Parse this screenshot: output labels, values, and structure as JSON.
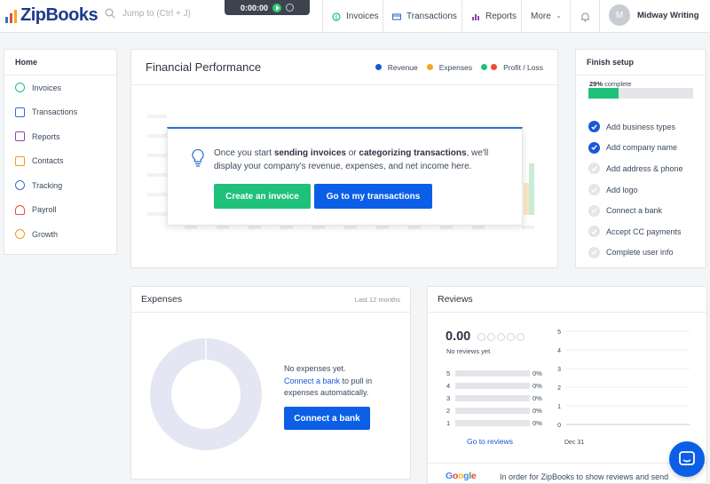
{
  "app": {
    "name": "ZipBooks"
  },
  "search": {
    "placeholder": "Jump to (Ctrl + J)"
  },
  "timer": {
    "time": "0:00:00"
  },
  "nav": [
    {
      "label": "Invoices",
      "icon": "invoice-icon"
    },
    {
      "label": "Transactions",
      "icon": "transactions-icon"
    },
    {
      "label": "Reports",
      "icon": "reports-icon"
    },
    {
      "label": "More",
      "icon": "chevron-down-icon"
    }
  ],
  "user": {
    "initial": "M",
    "name": "Midway Writing"
  },
  "sidebar": {
    "title": "Home",
    "items": [
      {
        "label": "Invoices",
        "icon": "invoice-icon",
        "color": "#1fc07a"
      },
      {
        "label": "Transactions",
        "icon": "transactions-icon",
        "color": "#2f6fd3"
      },
      {
        "label": "Reports",
        "icon": "reports-icon",
        "color": "#8e44ad"
      },
      {
        "label": "Contacts",
        "icon": "contacts-icon",
        "color": "#f39c12"
      },
      {
        "label": "Tracking",
        "icon": "tracking-icon",
        "color": "#2f6fd3"
      },
      {
        "label": "Payroll",
        "icon": "payroll-icon",
        "color": "#e74c3c"
      },
      {
        "label": "Growth",
        "icon": "growth-icon",
        "color": "#f39c12"
      }
    ]
  },
  "performance": {
    "title": "Financial Performance",
    "legend": [
      {
        "label": "Revenue",
        "colors": [
          "#1a57d8"
        ]
      },
      {
        "label": "Expenses",
        "colors": [
          "#f5a623"
        ]
      },
      {
        "label": "Profit / Loss",
        "colors": [
          "#1fc07a",
          "#e74c3c"
        ]
      }
    ],
    "message_pre": "Once you start ",
    "message_b1": "sending invoices",
    "message_mid": " or ",
    "message_b2": "categorizing transactions",
    "message_post": ", we'll display your company's revenue, expenses, and net income here.",
    "btn_invoice": "Create an invoice",
    "btn_transactions": "Go to my transactions"
  },
  "setup": {
    "title": "Finish setup",
    "percent_label": "29%",
    "complete_label": "complete",
    "progress": 0.29,
    "items": [
      {
        "label": "Add business types",
        "done": true
      },
      {
        "label": "Add company name",
        "done": true
      },
      {
        "label": "Add address & phone",
        "done": false
      },
      {
        "label": "Add logo",
        "done": false
      },
      {
        "label": "Connect a bank",
        "done": false
      },
      {
        "label": "Accept CC payments",
        "done": false
      },
      {
        "label": "Complete user info",
        "done": false
      }
    ]
  },
  "expenses": {
    "title": "Expenses",
    "range": "Last 12 months",
    "empty_line": "No expenses yet.",
    "link": "Connect a bank",
    "link_suffix": " to pull in expenses automatically.",
    "button": "Connect a bank"
  },
  "reviews": {
    "title": "Reviews",
    "rating": "0.00",
    "no_reviews": "No reviews yet",
    "distribution": [
      {
        "stars": "5",
        "pct": "0%"
      },
      {
        "stars": "4",
        "pct": "0%"
      },
      {
        "stars": "3",
        "pct": "0%"
      },
      {
        "stars": "2",
        "pct": "0%"
      },
      {
        "stars": "1",
        "pct": "0%"
      }
    ],
    "go_link": "Go to reviews",
    "chart_y_ticks": [
      "5",
      "4",
      "3",
      "2",
      "1",
      "0"
    ],
    "chart_x_label": "Dec 31",
    "google_brand": "Google",
    "google_text": "In order for ZipBooks to show reviews and send"
  }
}
